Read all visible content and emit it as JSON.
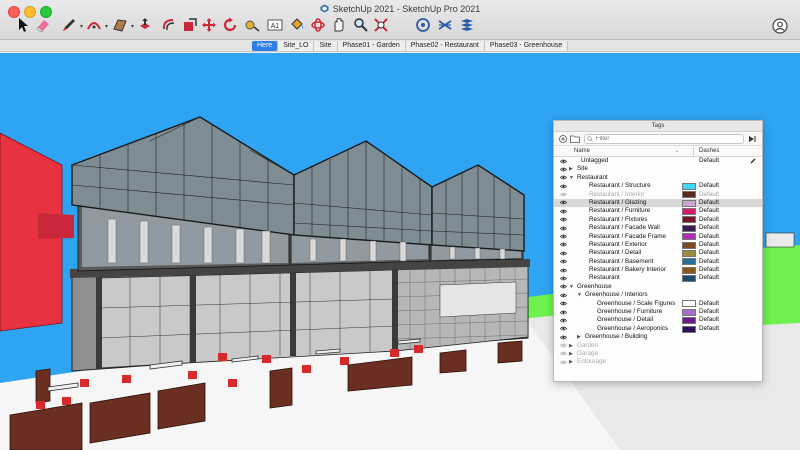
{
  "window": {
    "title": "SketchUp 2021 - SketchUp Pro 2021"
  },
  "toolbar": {
    "tools": [
      {
        "name": "select-tool",
        "icon": "arrow-cursor-icon"
      },
      {
        "name": "eraser-tool",
        "icon": "eraser-icon"
      },
      {
        "name": "pencil-tool",
        "icon": "pencil-icon"
      },
      {
        "name": "arc-tool",
        "icon": "arc-icon"
      },
      {
        "name": "shape-tool",
        "icon": "rectangle-icon"
      },
      {
        "name": "push-pull-tool",
        "icon": "push-pull-icon"
      },
      {
        "name": "offset-tool",
        "icon": "offset-icon"
      },
      {
        "name": "follow-me-tool",
        "icon": "follow-me-icon"
      },
      {
        "name": "move-tool",
        "icon": "move-icon"
      },
      {
        "name": "rotate-tool",
        "icon": "rotate-icon"
      },
      {
        "name": "tape-measure-tool",
        "icon": "tape-measure-icon"
      },
      {
        "name": "text-tool",
        "icon": "text-icon"
      },
      {
        "name": "paint-bucket-tool",
        "icon": "paint-bucket-icon"
      },
      {
        "name": "orbit-tool",
        "icon": "orbit-icon"
      },
      {
        "name": "pan-tool",
        "icon": "pan-icon"
      },
      {
        "name": "zoom-tool",
        "icon": "zoom-icon"
      },
      {
        "name": "zoom-extents-tool",
        "icon": "zoom-extents-icon"
      },
      {
        "name": "warehouse-tool",
        "icon": "warehouse-icon"
      },
      {
        "name": "extension-warehouse-tool",
        "icon": "extension-icon"
      },
      {
        "name": "layout-tool",
        "icon": "layout-icon"
      }
    ],
    "text_tool_label": "A1"
  },
  "scene_tabs": [
    {
      "label": "Here",
      "active": true
    },
    {
      "label": "Site_LO",
      "active": false
    },
    {
      "label": "Site",
      "active": false
    },
    {
      "label": "Phase01 - Garden",
      "active": false
    },
    {
      "label": "Phase02 - Restaurant",
      "active": false
    },
    {
      "label": "Phase03 - Greenhouse",
      "active": false
    }
  ],
  "tags_panel": {
    "title": "Tags",
    "filter_placeholder": "Filter",
    "col_name": "Name",
    "col_dashes": "Dashes",
    "rows": [
      {
        "label": "Untagged",
        "level": 0,
        "dash": "Default",
        "color": null,
        "tri": "",
        "dim": false,
        "selected": false,
        "pencil": true
      },
      {
        "label": "Site",
        "level": 0,
        "dash": "",
        "color": null,
        "tri": "▶",
        "dim": false,
        "selected": false
      },
      {
        "label": "Restaurant",
        "level": 0,
        "dash": "",
        "color": null,
        "tri": "▼",
        "dim": false,
        "selected": false
      },
      {
        "label": "Restaurant / Structure",
        "level": 1,
        "dash": "Default",
        "color": "#3fd9f4",
        "tri": "",
        "dim": false,
        "selected": false
      },
      {
        "label": "Restaurant / Interior",
        "level": 1,
        "dash": "Default",
        "color": "#5a2a1c",
        "tri": "",
        "dim": true,
        "selected": false
      },
      {
        "label": "Restaurant / Glazing",
        "level": 1,
        "dash": "Default",
        "color": "#c8a6cf",
        "tri": "",
        "dim": false,
        "selected": true
      },
      {
        "label": "Restaurant / Furniture",
        "level": 1,
        "dash": "Default",
        "color": "#d81b6a",
        "tri": "",
        "dim": false,
        "selected": false
      },
      {
        "label": "Restaurant / Fixtures",
        "level": 1,
        "dash": "Default",
        "color": "#7a1428",
        "tri": "",
        "dim": false,
        "selected": false
      },
      {
        "label": "Restaurant / Facade Wall",
        "level": 1,
        "dash": "Default",
        "color": "#3a1b52",
        "tri": "",
        "dim": false,
        "selected": false
      },
      {
        "label": "Restaurant / Facade Frame",
        "level": 1,
        "dash": "Default",
        "color": "#b12bb4",
        "tri": "",
        "dim": false,
        "selected": false
      },
      {
        "label": "Restaurant / Exterior",
        "level": 1,
        "dash": "Default",
        "color": "#7b4a22",
        "tri": "",
        "dim": false,
        "selected": false
      },
      {
        "label": "Restaurant / Detail",
        "level": 1,
        "dash": "Default",
        "color": "#9e8a3b",
        "tri": "",
        "dim": false,
        "selected": false
      },
      {
        "label": "Restaurant / Basement",
        "level": 1,
        "dash": "Default",
        "color": "#2a6f9a",
        "tri": "",
        "dim": false,
        "selected": false
      },
      {
        "label": "Restaurant / Bakery Interior",
        "level": 1,
        "dash": "Default",
        "color": "#8a5a14",
        "tri": "",
        "dim": false,
        "selected": false
      },
      {
        "label": "Restaurant",
        "level": 1,
        "dash": "Default",
        "color": "#1c4a6e",
        "tri": "",
        "dim": false,
        "selected": false
      },
      {
        "label": "Greenhouse",
        "level": 0,
        "dash": "",
        "color": null,
        "tri": "▼",
        "dim": false,
        "selected": false
      },
      {
        "label": "Greenhouse / Interiors",
        "level": 1,
        "dash": "",
        "color": null,
        "tri": "▼",
        "dim": false,
        "selected": false
      },
      {
        "label": "Greenhouse / Scale Figures",
        "level": 2,
        "dash": "Default",
        "color": "#ffffff",
        "tri": "",
        "dim": false,
        "selected": false
      },
      {
        "label": "Greenhouse / Furniture",
        "level": 2,
        "dash": "Default",
        "color": "#a56fd0",
        "tri": "",
        "dim": false,
        "selected": false
      },
      {
        "label": "Greenhouse / Detail",
        "level": 2,
        "dash": "Default",
        "color": "#6a1a8a",
        "tri": "",
        "dim": false,
        "selected": false
      },
      {
        "label": "Greenhouse / Aeroponics",
        "level": 2,
        "dash": "Default",
        "color": "#2a0f5c",
        "tri": "",
        "dim": false,
        "selected": false
      },
      {
        "label": "Greenhouse / Building",
        "level": 1,
        "dash": "",
        "color": null,
        "tri": "▶",
        "dim": false,
        "selected": false
      },
      {
        "label": "Garden",
        "level": 0,
        "dash": "",
        "color": null,
        "tri": "▶",
        "dim": true,
        "selected": false
      },
      {
        "label": "Garage",
        "level": 0,
        "dash": "",
        "color": null,
        "tri": "▶",
        "dim": true,
        "selected": false
      },
      {
        "label": "Entourage",
        "level": 0,
        "dash": "",
        "color": null,
        "tri": "▶",
        "dim": true,
        "selected": false
      }
    ]
  },
  "colors": {
    "sky": "#2ea4f2",
    "ground": "#f6f6f6",
    "lawn": "#6ff24f",
    "red_building": "#e8323f",
    "accent_tab": "#2d7fe4"
  }
}
